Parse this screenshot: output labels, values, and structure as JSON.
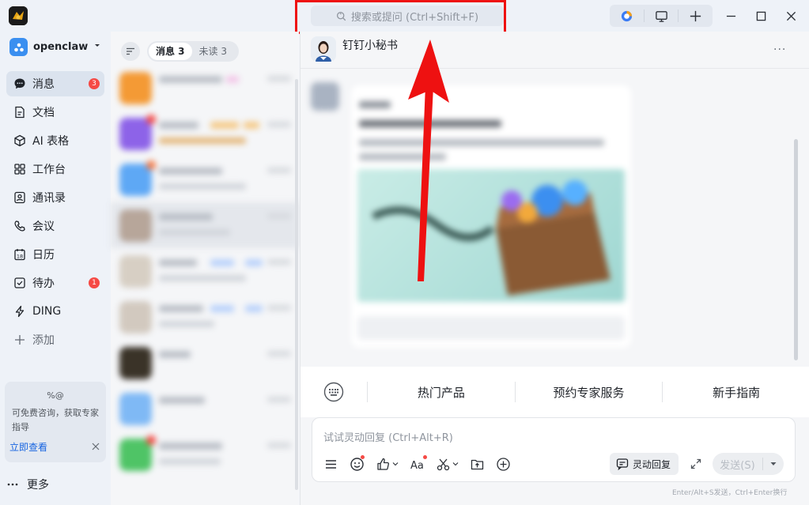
{
  "titlebar": {
    "search_placeholder": "搜索或提问 (Ctrl+Shift+F)"
  },
  "nav": {
    "org_name": "openclaw",
    "items": [
      {
        "label": "消息",
        "badge": "3"
      },
      {
        "label": "文档",
        "badge": ""
      },
      {
        "label": "AI 表格",
        "badge": ""
      },
      {
        "label": "工作台",
        "badge": ""
      },
      {
        "label": "通讯录",
        "badge": ""
      },
      {
        "label": "会议",
        "badge": ""
      },
      {
        "label": "日历",
        "badge": ""
      },
      {
        "label": "待办",
        "badge": "1"
      },
      {
        "label": "DING",
        "badge": ""
      },
      {
        "label": "添加",
        "badge": ""
      }
    ],
    "promo": {
      "title": "%@",
      "text": "可免费咨询，获取专家指导",
      "link": "立即查看"
    },
    "more_label": "更多"
  },
  "conversation_list": {
    "tabs": [
      {
        "label": "消息 3",
        "active": true
      },
      {
        "label": "未读 3",
        "active": false
      }
    ]
  },
  "chat": {
    "title": "钉钉小秘书",
    "more": "···",
    "quick_actions": [
      "热门产品",
      "预约专家服务",
      "新手指南"
    ],
    "input_placeholder": "试试灵动回复 (Ctrl+Alt+R)",
    "smart_reply_label": "灵动回复",
    "send_label": "发送(S)",
    "hint": "Enter/Alt+S发送，Ctrl+Enter换行"
  },
  "colors": {
    "highlight": "#ee1111",
    "accent": "#1764e0",
    "badge": "#f54a45"
  }
}
